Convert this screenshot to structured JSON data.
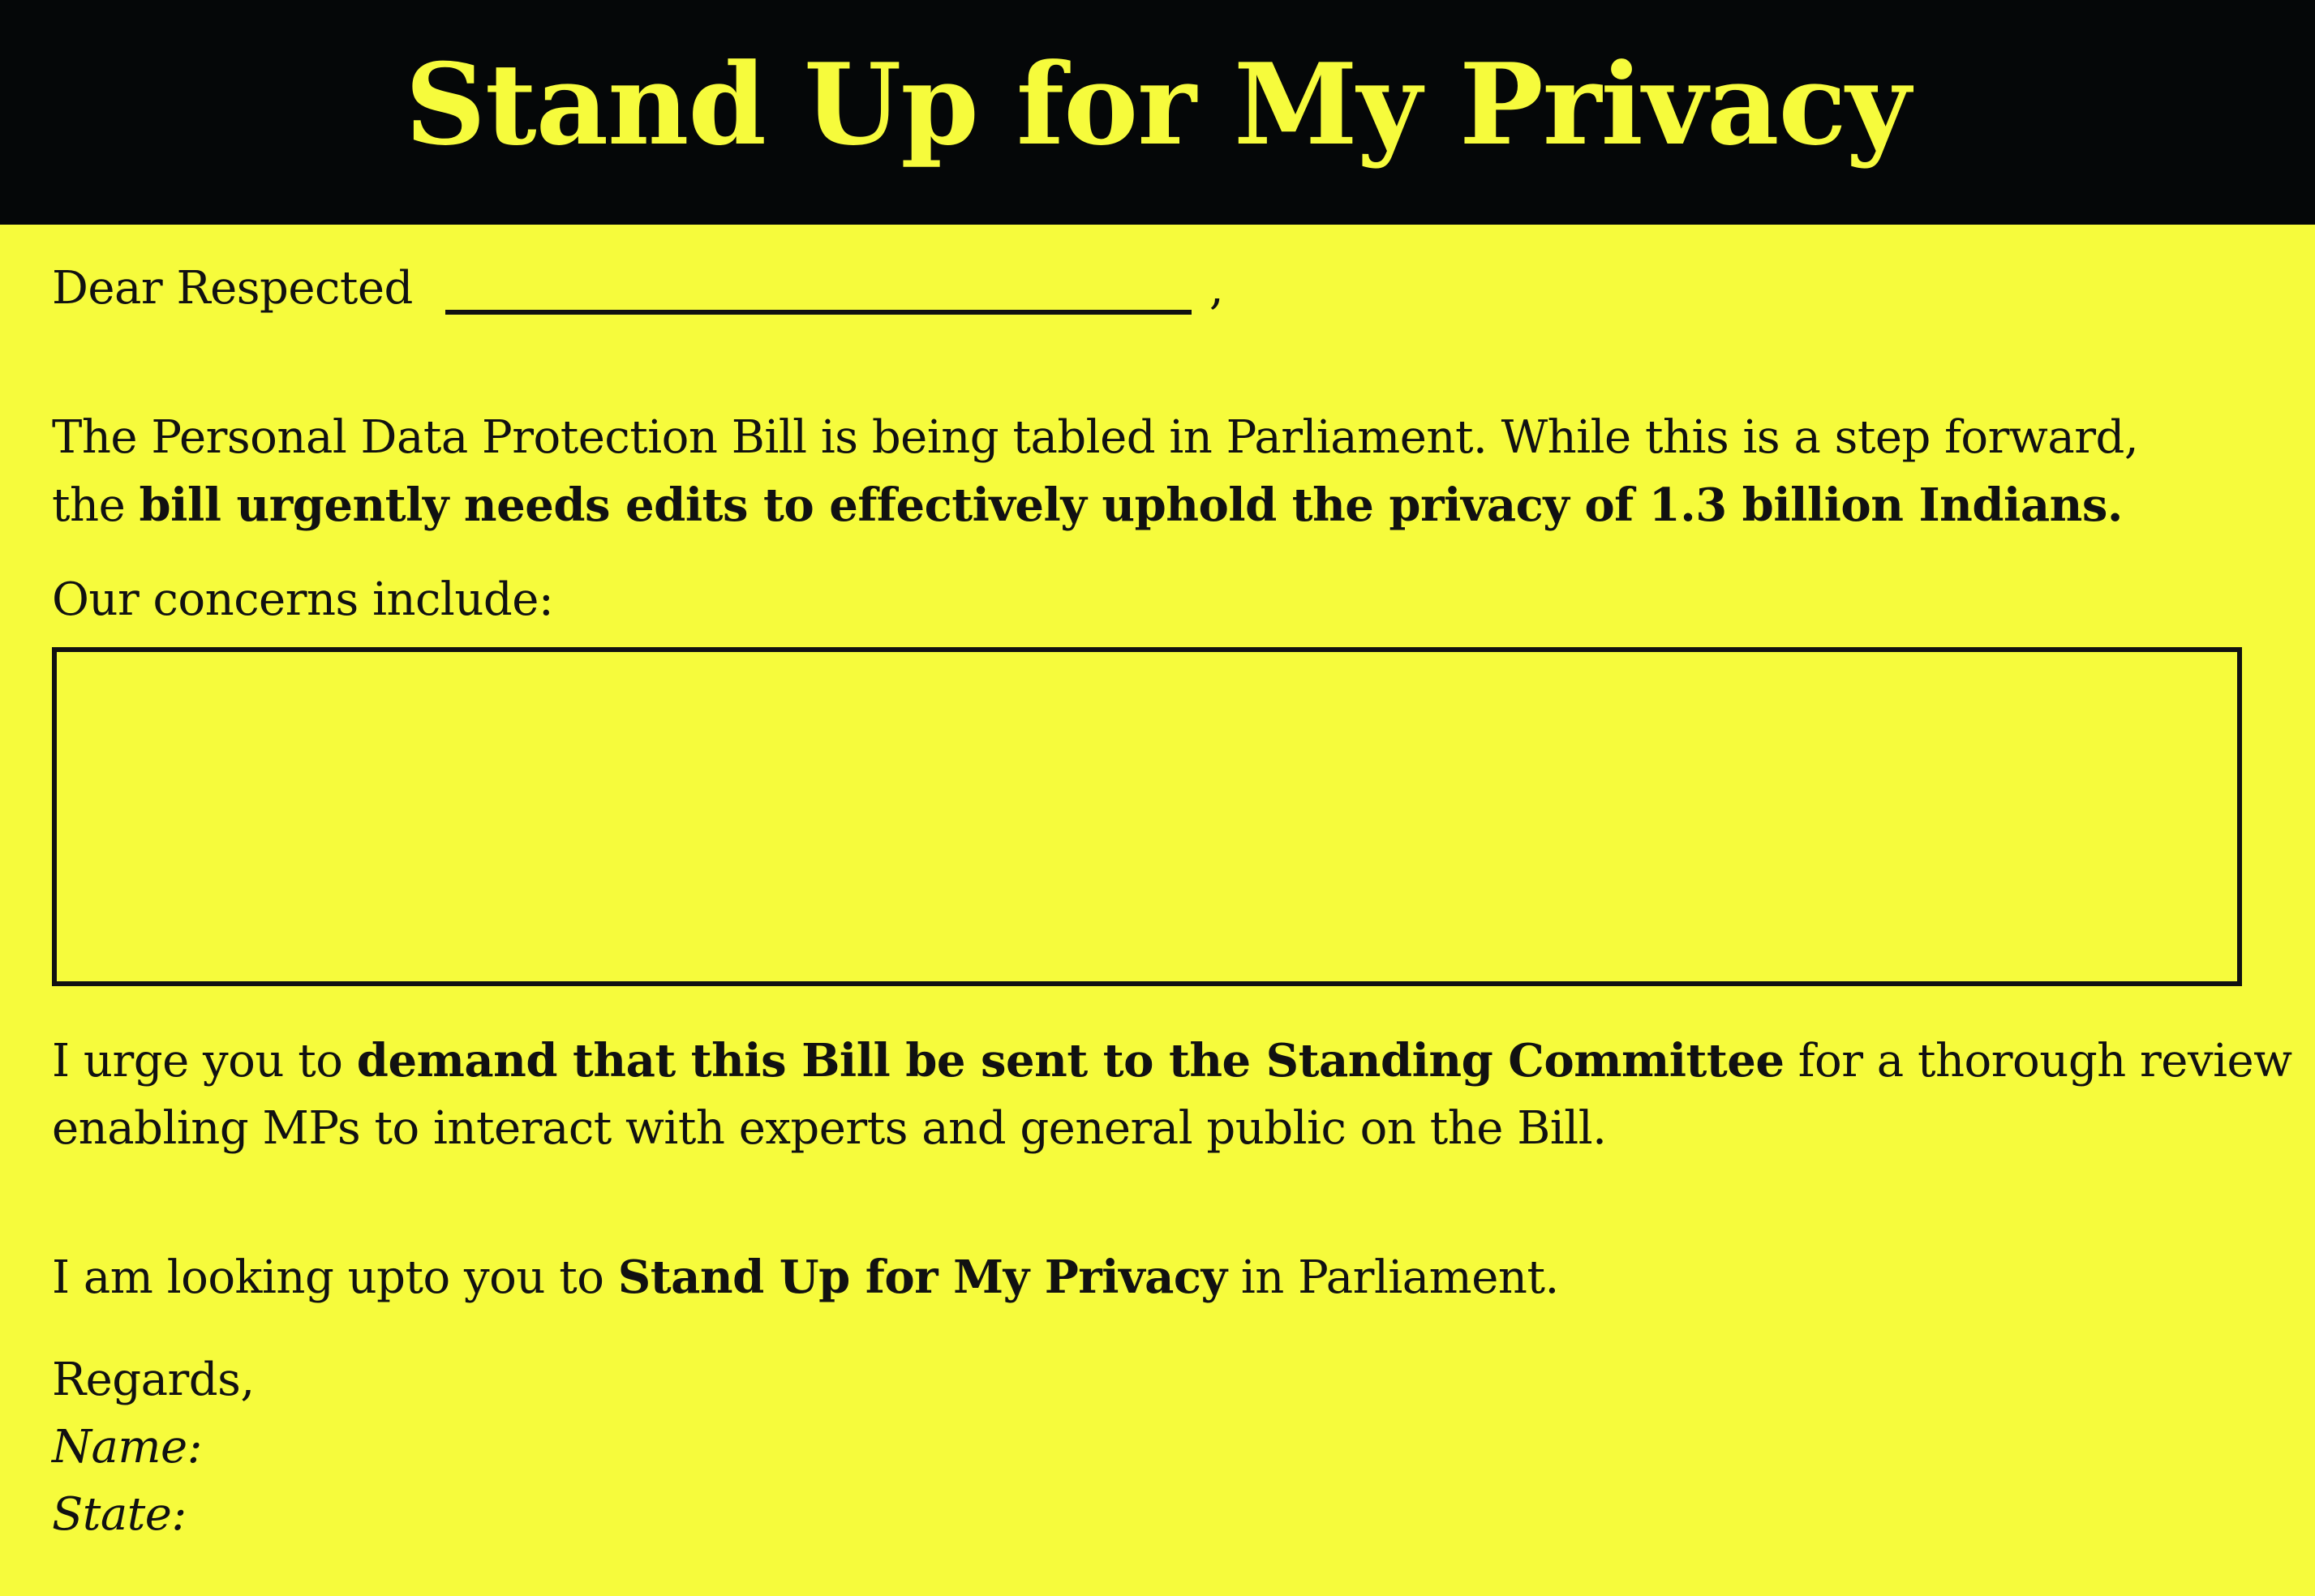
{
  "header": {
    "title": "Stand Up for My Privacy"
  },
  "letter": {
    "salutation_prefix": "Dear Respected",
    "salutation_suffix": ",",
    "para1_line1": "The Personal Data Protection Bill is being tabled in Parliament. While this is a step forward,",
    "para1_line2_plain": "the ",
    "para1_line2_bold": "bill urgently needs edits to effectively uphold the privacy of 1.3 billion Indians.",
    "concerns_label": "Our concerns include:",
    "concerns_value": "",
    "para2_line1_plain_start": "I urge you to ",
    "para2_line1_bold": "demand that this Bill be sent to the Standing Committee",
    "para2_line1_plain_end": " for a thorough review",
    "para2_line2": "enabling MPs to interact with experts and general public on the Bill.",
    "para3_plain_start": "I am looking upto you to ",
    "para3_bold": "Stand Up for My Privacy",
    "para3_plain_end": " in Parliament.",
    "regards": "Regards,",
    "name_label": "Name:",
    "state_label": "State:"
  },
  "colors": {
    "background": "#f6fb3c",
    "banner": "#050708",
    "text": "#111111"
  }
}
